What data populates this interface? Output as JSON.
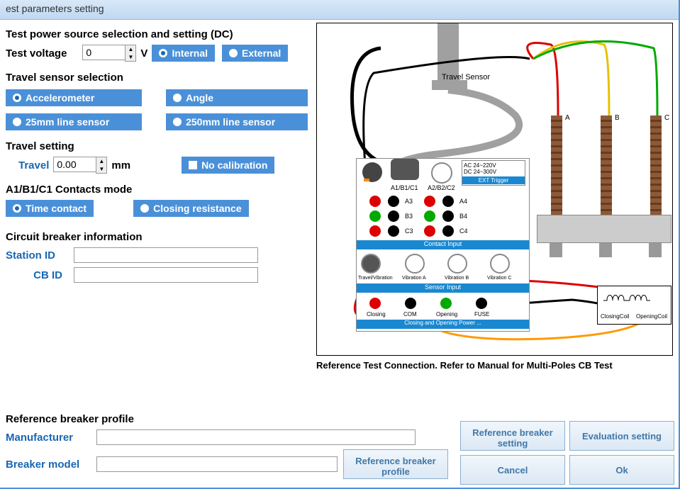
{
  "title": "est parameters setting",
  "sections": {
    "power": {
      "title": "Test power source selection and setting (DC)",
      "voltage_label": "Test voltage",
      "voltage_value": "0",
      "voltage_unit": "V",
      "internal": "Internal",
      "external": "External"
    },
    "sensor": {
      "title": "Travel sensor selection",
      "accel": "Accelerometer",
      "angle": "Angle",
      "line25": "25mm line sensor",
      "line250": "250mm line sensor"
    },
    "travel": {
      "title": "Travel setting",
      "label": "Travel",
      "value": "0.00",
      "unit": "mm",
      "nocal": "No calibration"
    },
    "contacts": {
      "title": "A1/B1/C1 Contacts mode",
      "time": "Time contact",
      "closing": "Closing resistance"
    },
    "cbinfo": {
      "title": "Circuit breaker information",
      "station": "Station ID",
      "cbid": "CB ID"
    },
    "profile": {
      "title": "Reference breaker profile",
      "mfr": "Manufacturer",
      "model": "Breaker model"
    }
  },
  "diagram": {
    "travel_sensor": "Travel Sensor",
    "abc": {
      "a": "A",
      "b": "B",
      "c": "C"
    },
    "ports": {
      "a1": "A1/B1/C1",
      "a2": "A2/B2/C2",
      "a3": "A3",
      "a4": "A4",
      "b3": "B3",
      "b4": "B4",
      "c3": "C3",
      "c4": "C4"
    },
    "contact_input": "Contact Input",
    "sensor_input": "Sensor Input",
    "travel_vib": "Travel/Vibration",
    "vib_a": "Vibration A",
    "vib_b": "Vibration B",
    "vib_c": "Vibration C",
    "closing_power": "Closing and Opening Power ...",
    "closing": "Closing",
    "com": "COM",
    "opening": "Opening",
    "fuse": "FUSE",
    "ac_spec": "AC 24~220V\nDC 24~300V",
    "ext_trigger": "EXT Trigger",
    "closing_coil": "ClosingCoil",
    "opening_coil": "OpeningCoil",
    "caption": "Reference Test Connection. Refer to Manual for Multi-Poles CB Test"
  },
  "buttons": {
    "ref_setting": "Reference breaker setting",
    "eval_setting": "Evaluation setting",
    "cancel": "Cancel",
    "ok": "Ok",
    "ref_profile": "Reference breaker profile"
  }
}
